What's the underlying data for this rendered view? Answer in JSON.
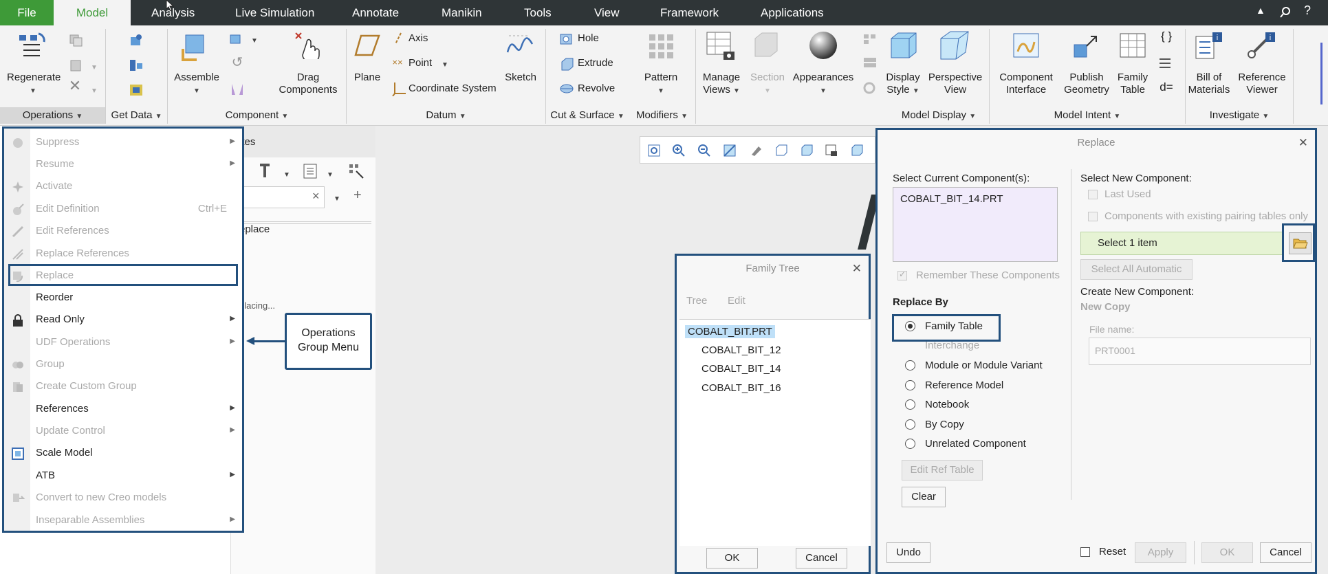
{
  "tabs": [
    "File",
    "Model",
    "Analysis",
    "Live Simulation",
    "Annotate",
    "Manikin",
    "Tools",
    "View",
    "Framework",
    "Applications"
  ],
  "ribbon": {
    "regenerate": "Regenerate",
    "assemble": "Assemble",
    "drag_components": [
      "Drag",
      "Components"
    ],
    "plane": "Plane",
    "axis": "Axis",
    "point": "Point",
    "coordinate_system": "Coordinate System",
    "sketch": "Sketch",
    "hole": "Hole",
    "extrude": "Extrude",
    "revolve": "Revolve",
    "pattern": "Pattern",
    "manage_views": [
      "Manage",
      "Views"
    ],
    "section": "Section",
    "appearances": "Appearances",
    "display_style": [
      "Display",
      "Style"
    ],
    "perspective_view": [
      "Perspective",
      "View"
    ],
    "component_interface": [
      "Component",
      "Interface"
    ],
    "publish_geometry": [
      "Publish",
      "Geometry"
    ],
    "family_table": [
      "Family",
      "Table"
    ],
    "bill_of_materials": [
      "Bill of",
      "Materials"
    ],
    "reference_viewer": [
      "Reference",
      "Viewer"
    ]
  },
  "groups": [
    "Operations",
    "Get Data",
    "Component",
    "Datum",
    "Cut & Surface",
    "Modifiers",
    "Model Display",
    "Model Intent",
    "Investigate"
  ],
  "menu": {
    "items": [
      {
        "label": "Suppress",
        "shortcut": ""
      },
      {
        "label": "Resume",
        "shortcut": ""
      },
      {
        "label": "Activate",
        "shortcut": ""
      },
      {
        "label": "Edit Definition",
        "shortcut": "Ctrl+E"
      },
      {
        "label": "Edit References",
        "shortcut": ""
      },
      {
        "label": "Replace References",
        "shortcut": ""
      },
      {
        "label": "Replace",
        "shortcut": ""
      },
      {
        "label": "Reorder",
        "shortcut": ""
      },
      {
        "label": "Read Only",
        "shortcut": ""
      },
      {
        "label": "UDF Operations",
        "shortcut": ""
      },
      {
        "label": "Group",
        "shortcut": ""
      },
      {
        "label": "Create Custom Group",
        "shortcut": ""
      },
      {
        "label": "References",
        "shortcut": ""
      },
      {
        "label": "Update Control",
        "shortcut": ""
      },
      {
        "label": "Scale Model",
        "shortcut": ""
      },
      {
        "label": "ATB",
        "shortcut": ""
      },
      {
        "label": "Convert to new Creo models",
        "shortcut": ""
      },
      {
        "label": "Inseparable Assemblies",
        "shortcut": ""
      }
    ]
  },
  "callout": [
    "Operations",
    "Group Menu"
  ],
  "leftpane": {
    "header": "ites",
    "search_clear": "×",
    "item": "eplace",
    "status": "placing..."
  },
  "family_tree": {
    "title": "Family Tree",
    "menu": [
      "Tree",
      "Edit"
    ],
    "root": "COBALT_BIT.PRT",
    "children": [
      "COBALT_BIT_12",
      "COBALT_BIT_14",
      "COBALT_BIT_16"
    ],
    "ok": "OK",
    "cancel": "Cancel"
  },
  "replace": {
    "title": "Replace",
    "select_current": "Select Current Component(s):",
    "current_value": "COBALT_BIT_14.PRT",
    "remember": "Remember These Components",
    "replace_by": "Replace By",
    "options": [
      "Family Table",
      "Interchange",
      "Module or Module Variant",
      "Reference Model",
      "Notebook",
      "By Copy",
      "Unrelated Component"
    ],
    "edit_ref_table": "Edit Ref Table",
    "clear": "Clear",
    "select_new": "Select New Component:",
    "last_used": "Last Used",
    "pairing_only": "Components with existing pairing tables only",
    "select_item": "Select 1 item",
    "select_all_automatic": "Select All Automatic",
    "create_new": "Create New Component:",
    "new_copy": "New Copy",
    "file_name_label": "File name:",
    "file_name_placeholder": "PRT0001",
    "undo": "Undo",
    "reset": "Reset",
    "apply": "Apply",
    "ok": "OK",
    "cancel": "Cancel"
  },
  "colors": {
    "accent": "#3e9a38",
    "highlight": "#23507d",
    "tabbar": "#2f3537"
  }
}
